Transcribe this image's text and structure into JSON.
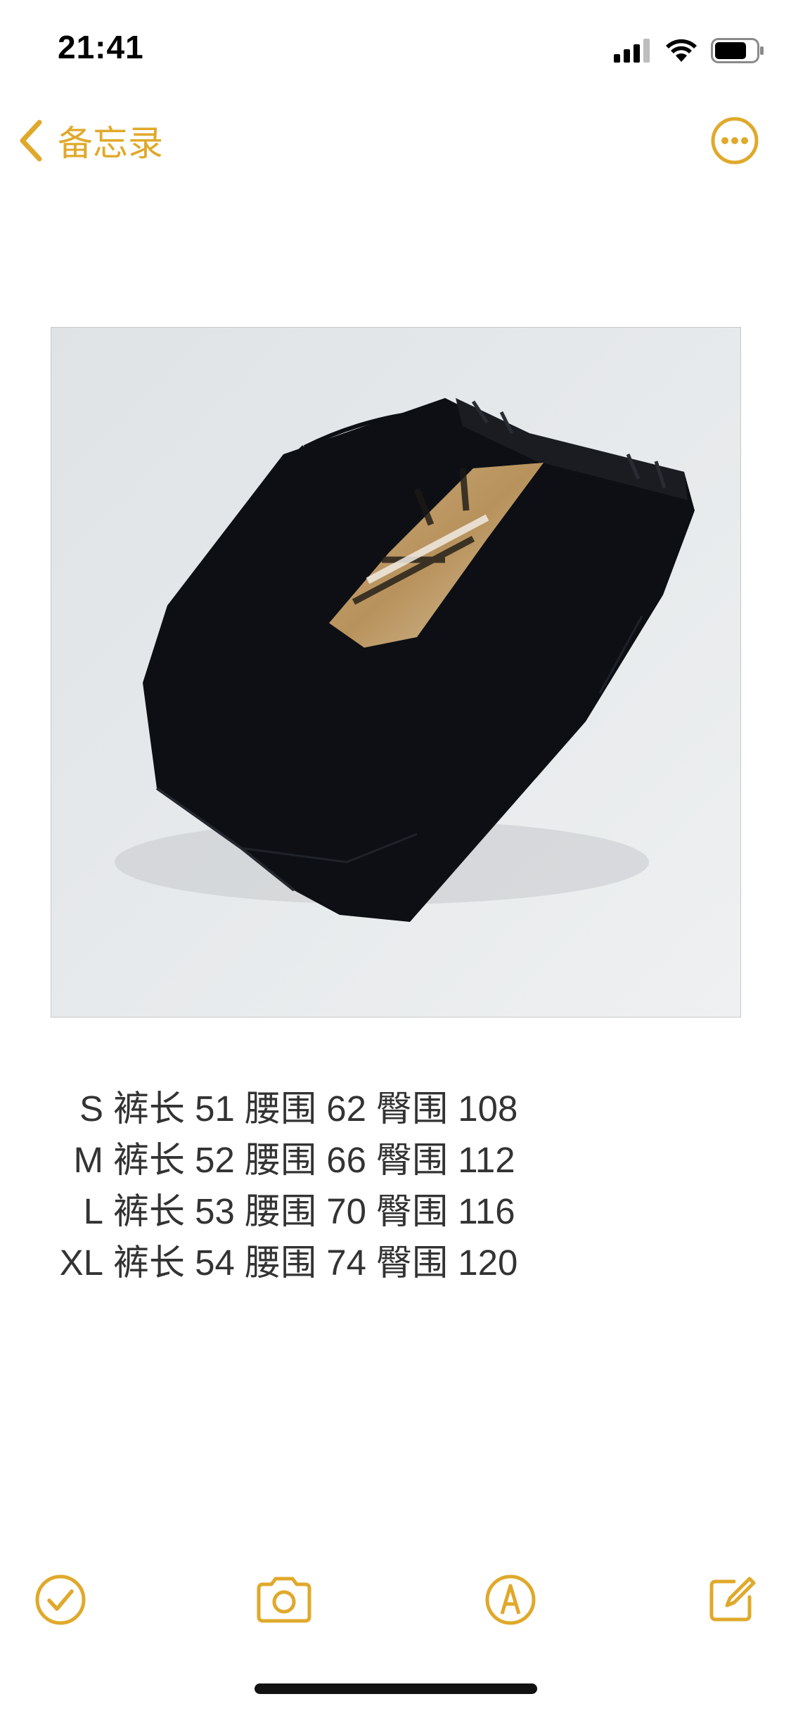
{
  "status_bar": {
    "time": "21:41",
    "icons": [
      "cellular-signal-icon",
      "wifi-icon",
      "battery-icon"
    ]
  },
  "nav": {
    "back_label": "备忘录",
    "accent_color": "#E0A92B"
  },
  "note": {
    "image_description_icon": "shorts-photo",
    "size_rows": [
      {
        "size": "S",
        "text": "裤长 51 腰围 62 臀围 108"
      },
      {
        "size": "M",
        "text": "裤长 52 腰围 66 臀围 112"
      },
      {
        "size": "L",
        "text": "裤长 53 腰围 70 臀围 116"
      },
      {
        "size": "XL",
        "text": "裤长 54 腰围 74 臀围 120"
      }
    ]
  },
  "toolbar": {
    "items": [
      "checklist-icon",
      "camera-icon",
      "markup-icon",
      "compose-icon"
    ]
  }
}
